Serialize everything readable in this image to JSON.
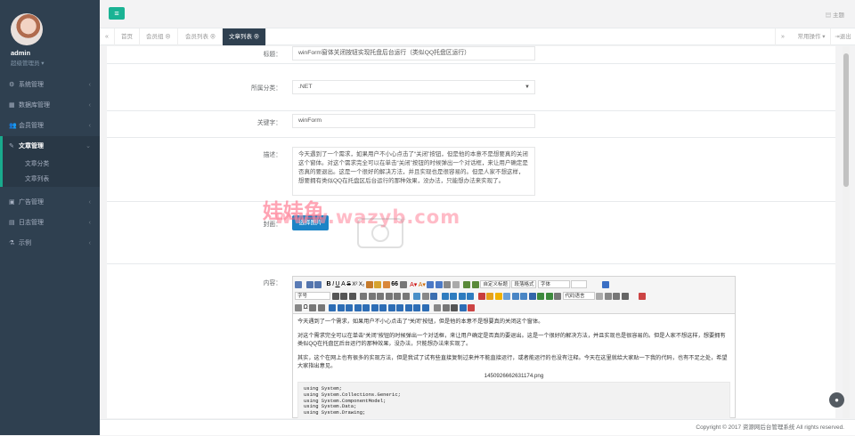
{
  "sidebar": {
    "username": "admin",
    "role": "超级管理员",
    "items": [
      {
        "label": "系统管理",
        "icon": "gear-icon",
        "glyph": "⚙"
      },
      {
        "label": "数据库管理",
        "icon": "table-icon",
        "glyph": "▦"
      },
      {
        "label": "会员管理",
        "icon": "users-icon",
        "glyph": "👥"
      },
      {
        "label": "文章管理",
        "icon": "edit-icon",
        "glyph": "✎"
      },
      {
        "label": "广告管理",
        "icon": "image-icon",
        "glyph": "▣"
      },
      {
        "label": "日志管理",
        "icon": "list-icon",
        "glyph": "▤"
      },
      {
        "label": "示例",
        "icon": "flask-icon",
        "glyph": "⚗"
      }
    ],
    "subitems": [
      "文章分类",
      "文章列表"
    ]
  },
  "topbar": {
    "theme": "主题"
  },
  "tabs": {
    "items": [
      "首页",
      "会员组 ⊗",
      "会员列表 ⊗",
      "文章列表 ⊗"
    ],
    "actions": "常用操作 ▾",
    "logout": "退出"
  },
  "form": {
    "title_label": "标题：",
    "title_value": "winForm窗体关闭按钮实现托盘后台运行（类似QQ托盘区运行）",
    "category_label": "所属分类：",
    "category_value": ".NET",
    "keywords_label": "关键字：",
    "keywords_value": "winForm",
    "desc_label": "描述：",
    "desc_value": "今天遇到了一个需求，如果用户不小心点击了“关闭”按钮，但是他的本意不是想要真的关闭这个窗体。对这个需求完全可以在单击“关闭”按钮的时候弹出一个对话框，来让用户确定是否真的要退出。这是一个很好的解决方法，并且实现也是很容易的。但是人家不想这样，想要拥有类似QQ在托盘区后台运行的那种效果，没办法，只能想办法来实现了。",
    "cover_label": "封面：",
    "cover_button": "选择图片",
    "content_label": "内容："
  },
  "editor": {
    "font_family": "自定义标题",
    "para_format": "段落格式",
    "font": "字体",
    "font_size": "字号",
    "code_lang": "代码语言",
    "para1": "今天遇到了一个需求，如果用户不小心点击了“关闭”按钮，但是他的本意不是想要真的关闭这个窗体。",
    "para2": "对这个需求完全可以在单击“关闭”按钮的时候弹出一个对话框，来让用户确定是否真的要退出。这是一个很好的解决方法，并且实现也是很容易的。但是人家不想这样，想要拥有类似QQ在托盘区后台运行的那种效果，没办法，只能想办法来实现了。",
    "para3": "其实，这个在网上也有很多的实现方法，但是我试了试有些直接复制过来并不能直接运行，或者能运行的也没有注释。今天在这里就给大家贴一下我的代码，也有不足之处，希望大家指出意见。",
    "image_name": "1450926662631174.png",
    "code_lines": [
      "using  System;",
      "using  System.Collections.Generic;",
      "using  System.ComponentModel;",
      "using  System.Data;",
      "using  System.Drawing;"
    ]
  },
  "watermark": {
    "line1": "娃娃鱼",
    "line2": "www.wazyb.com"
  },
  "footer": "Copyright © 2017 资源网后台管理系统 All rights reserved.",
  "colors": {
    "sidebar": "#2f4050",
    "accent": "#1ab394",
    "primary": "#1c84c6"
  }
}
